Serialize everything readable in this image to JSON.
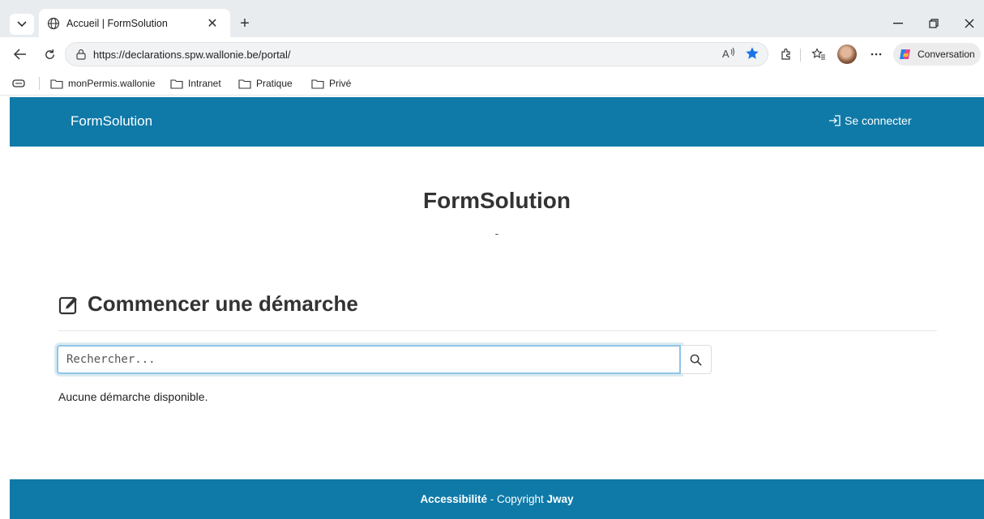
{
  "browser": {
    "tab_title": "Accueil | FormSolution",
    "tab_close": "✕",
    "new_tab": "+",
    "url": "https://declarations.spw.wallonie.be/portal/",
    "copilot_label": "Conversation",
    "favorites": [
      "monPermis.wallonie",
      "Intranet",
      "Pratique",
      "Privé"
    ]
  },
  "site": {
    "brand": "FormSolution",
    "login_label": "Se connecter",
    "hero_title": "FormSolution",
    "hero_subtitle": "-",
    "section_title": "Commencer une démarche",
    "search_placeholder": "Rechercher...",
    "empty_message": "Aucune démarche disponible.",
    "footer": {
      "accessibility": "Accessibilité",
      "separator": " - Copyright ",
      "company": "Jway"
    }
  },
  "colors": {
    "brand_blue": "#0f7aa8",
    "focus_border": "#8ec5e5",
    "favorite_star": "#1a73e8"
  },
  "icons": [
    "tab-list-icon",
    "globe-icon",
    "close-icon",
    "back-icon",
    "refresh-icon",
    "site-info-icon",
    "read-aloud-icon",
    "favorite-star-icon",
    "extensions-icon",
    "favorites-icon",
    "more-icon",
    "copilot-icon",
    "collections-icon",
    "folder-icon",
    "login-icon",
    "edit-icon",
    "search-icon"
  ]
}
